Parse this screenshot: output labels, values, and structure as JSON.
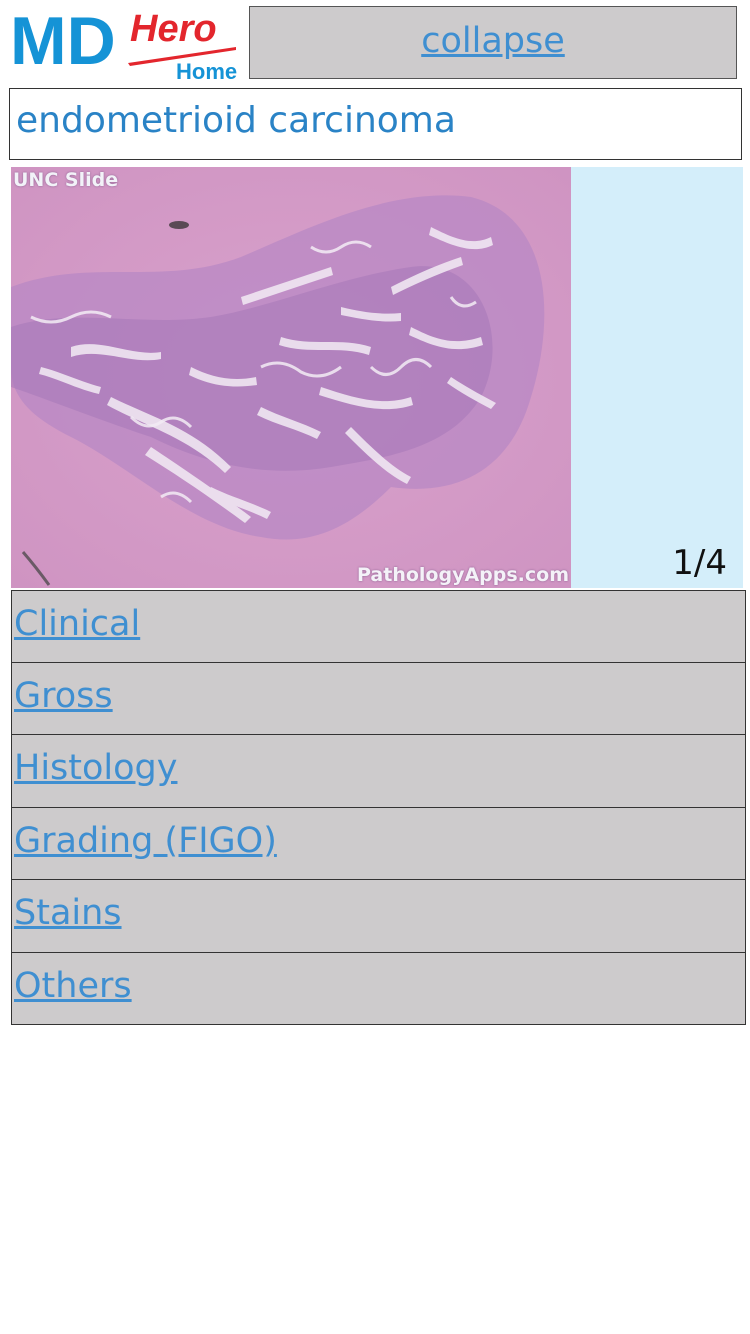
{
  "header": {
    "logo": {
      "md": "MD",
      "hero": "Hero",
      "home": "Home"
    },
    "collapse_label": "collapse"
  },
  "title": "endometrioid carcinoma",
  "viewer": {
    "slide_label": "UNC Slide",
    "watermark": "PathologyApps.com",
    "counter": "1/4"
  },
  "sections": [
    {
      "label": "Clinical"
    },
    {
      "label": "Gross"
    },
    {
      "label": "Histology"
    },
    {
      "label": "Grading (FIGO)"
    },
    {
      "label": "Stains"
    },
    {
      "label": "Others"
    }
  ],
  "colors": {
    "logo_blue": "#1593d6",
    "logo_red": "#e3262d",
    "link_blue": "#3f8fd1",
    "panel_gray": "#cdcbcc",
    "viewer_bg": "#d4eefa"
  }
}
